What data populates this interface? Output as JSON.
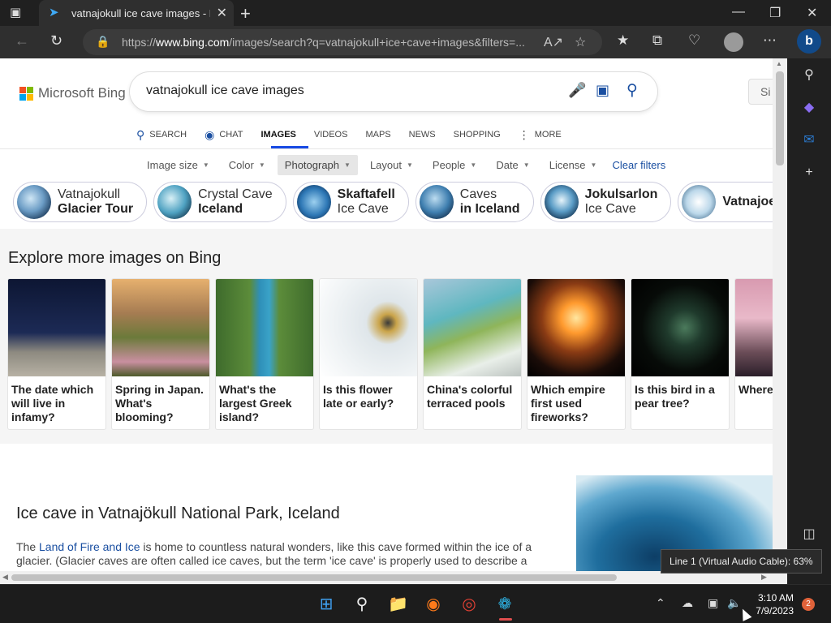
{
  "browser": {
    "tab_title": "vatnajokull ice cave images - Bing",
    "url_prefix": "https://",
    "url_host": "www.bing.com",
    "url_path": "/images/search?q=vatnajokull+ice+cave+images&filters=..."
  },
  "page": {
    "logo_text": "Microsoft Bing",
    "search_query": "vatnajokull ice cave images",
    "signin_label": "Si",
    "scopes": [
      {
        "label": "SEARCH",
        "icon": "search-icon"
      },
      {
        "label": "CHAT",
        "icon": "chat-icon"
      },
      {
        "label": "IMAGES",
        "icon": ""
      },
      {
        "label": "VIDEOS",
        "icon": ""
      },
      {
        "label": "MAPS",
        "icon": ""
      },
      {
        "label": "NEWS",
        "icon": ""
      },
      {
        "label": "SHOPPING",
        "icon": ""
      },
      {
        "label": "MORE",
        "icon": "more-vertical-icon"
      }
    ],
    "filters": [
      "Image size",
      "Color",
      "Photograph",
      "Layout",
      "People",
      "Date",
      "License"
    ],
    "clear_filters": "Clear filters",
    "chips": [
      {
        "line1": "Vatnajokull",
        "line2": "Glacier Tour",
        "bold_line": 2
      },
      {
        "line1": "Crystal Cave",
        "line2": "Iceland",
        "bold_line": 2
      },
      {
        "line1": "Skaftafell",
        "line2": "Ice Cave",
        "bold_line": 1
      },
      {
        "line1": "Caves",
        "line2": "in Iceland",
        "bold_line": 2
      },
      {
        "line1": "Jokulsarlon",
        "line2": "Ice Cave",
        "bold_line": 1
      },
      {
        "line1": "Vatnajoel",
        "line2": "",
        "bold_line": 1
      }
    ],
    "explore_title": "Explore more images on Bing",
    "cards": [
      {
        "caption": "The date which will live in infamy?"
      },
      {
        "caption": "Spring in Japan. What's blooming?"
      },
      {
        "caption": "What's the largest Greek island?"
      },
      {
        "caption": "Is this flower late or early?"
      },
      {
        "caption": "China's colorful terraced pools"
      },
      {
        "caption": "Which empire first used fireworks?"
      },
      {
        "caption": "Is this bird in a pear tree?"
      },
      {
        "caption": "Where cherry"
      }
    ],
    "article_title": "Ice cave in Vatnajökull National Park, Iceland",
    "article_intro_pre": "The ",
    "article_link": "Land of Fire and Ice",
    "article_intro_post": " is home to countless natural wonders, like this cave formed within the ice of a glacier. (Glacier caves are often called ice caves, but the term 'ice cave' is properly used to describe a"
  },
  "tooltip": "Line 1 (Virtual Audio Cable): 63%",
  "taskbar": {
    "time": "3:10 AM",
    "date": "7/9/2023",
    "notifications": "2"
  }
}
